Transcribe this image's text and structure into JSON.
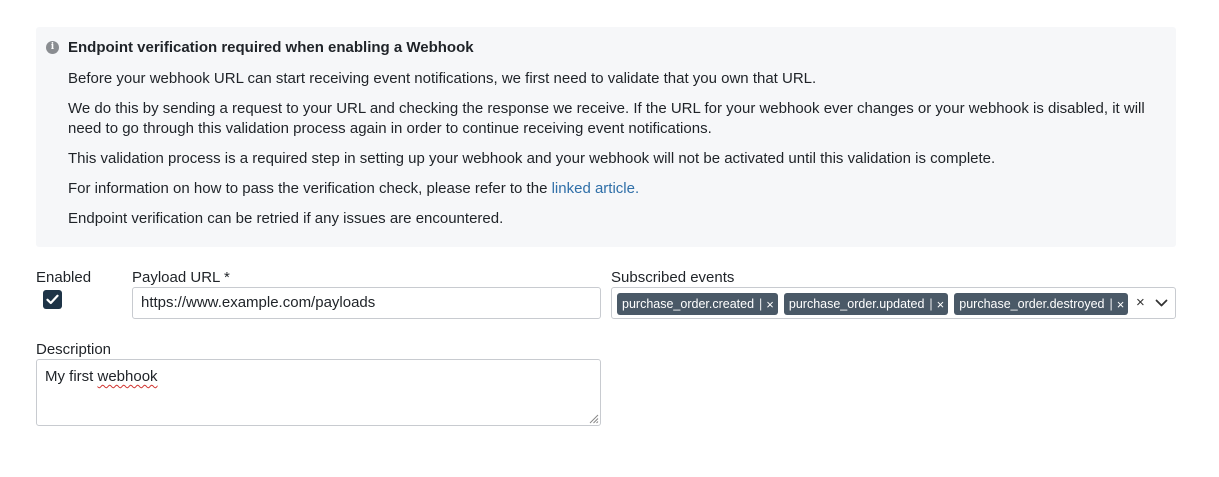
{
  "notice": {
    "icon": "info-icon",
    "title": "Endpoint verification required when enabling a Webhook",
    "p1": "Before your webhook URL can start receiving event notifications, we first need to validate that you own that URL.",
    "p2": "We do this by sending a request to your URL and checking the response we receive. If the URL for your webhook ever changes or your webhook is disabled, it will need to go through this validation process again in order to continue receiving event notifications.",
    "p3": "This validation process is a required step in setting up your webhook and your webhook will not be activated until this validation is complete.",
    "p4_prefix": "For information on how to pass the verification check, please refer to the ",
    "p4_link": "linked article.",
    "p5": "Endpoint verification can be retried if any issues are encountered.",
    "link_color": "#2f6fa8"
  },
  "form": {
    "enabled_label": "Enabled",
    "enabled_checked": true,
    "payload_url_label": "Payload URL *",
    "payload_url_value": "https://www.example.com/payloads",
    "subscribed_events_label": "Subscribed events",
    "subscribed_events": [
      "purchase_order.created",
      "purchase_order.updated",
      "purchase_order.destroyed"
    ],
    "tag_separator": "|",
    "tag_remove": "×",
    "clear_all": "×",
    "description_label": "Description",
    "description_value_plain": "My first ",
    "description_value_flagged": "webhook"
  },
  "colors": {
    "notice_bg": "#f6f7f9",
    "checkbox_bg": "#1e3447",
    "tag_bg": "#4a5967"
  }
}
